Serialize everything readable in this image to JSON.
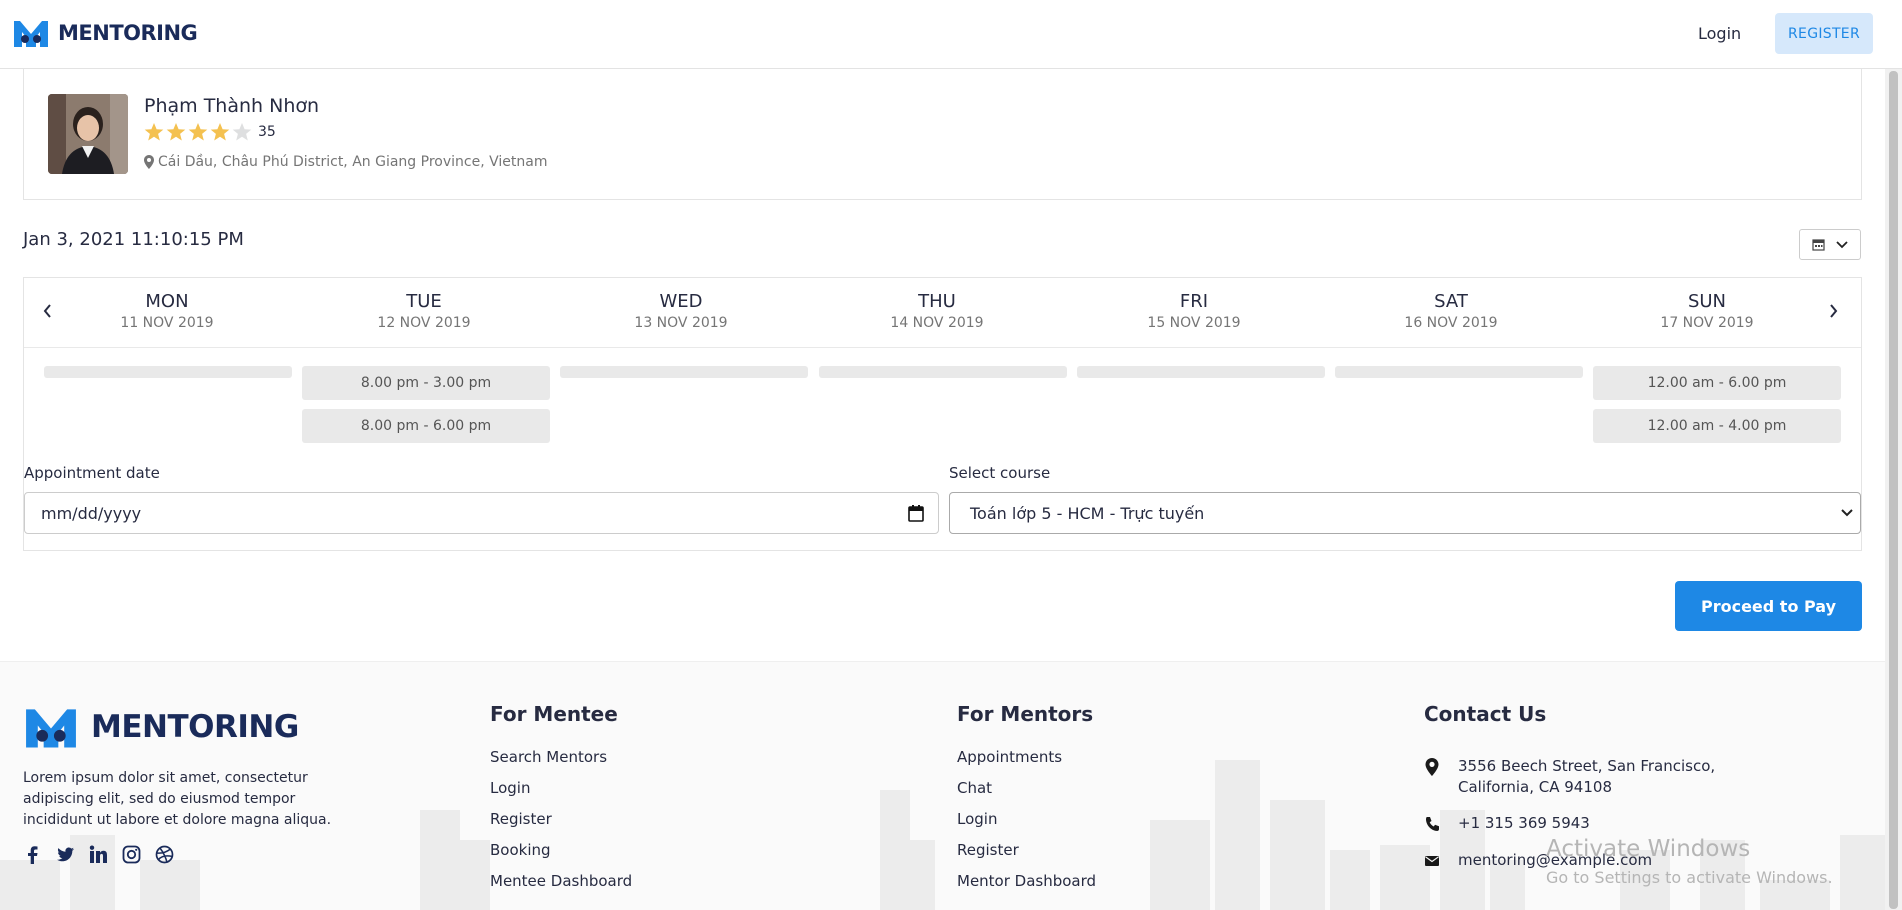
{
  "header": {
    "brand": "MENTORING",
    "login": "Login",
    "register": "REGISTER"
  },
  "mentor": {
    "name": "Phạm Thành Nhơn",
    "rating": 4,
    "rating_max": 5,
    "review_count": "35",
    "location": "Cái Dầu, Châu Phú District, An Giang Province, Vietnam"
  },
  "schedule": {
    "current_datetime": "Jan 3, 2021 11:10:15 PM",
    "days": [
      {
        "name": "MON",
        "date": "11 NOV 2019",
        "slots": []
      },
      {
        "name": "TUE",
        "date": "12 NOV 2019",
        "slots": [
          "8.00 pm - 3.00 pm",
          "8.00 pm - 6.00 pm"
        ]
      },
      {
        "name": "WED",
        "date": "13 NOV 2019",
        "slots": []
      },
      {
        "name": "THU",
        "date": "14 NOV 2019",
        "slots": []
      },
      {
        "name": "FRI",
        "date": "15 NOV 2019",
        "slots": []
      },
      {
        "name": "SAT",
        "date": "16 NOV 2019",
        "slots": []
      },
      {
        "name": "SUN",
        "date": "17 NOV 2019",
        "slots": [
          "12.00 am - 6.00 pm",
          "12.00 am - 4.00 pm"
        ]
      }
    ]
  },
  "form": {
    "date_label": "Appointment date",
    "date_placeholder": "mm/dd/yyyy",
    "course_label": "Select course",
    "course_value": "Toán lớp 5 - HCM - Trực tuyến"
  },
  "pay_button": "Proceed to Pay",
  "footer": {
    "brand": "MENTORING",
    "about": "Lorem ipsum dolor sit amet, consectetur adipiscing elit, sed do eiusmod tempor incididunt ut labore et dolore magna aliqua.",
    "mentee": {
      "title": "For Mentee",
      "links": [
        "Search Mentors",
        "Login",
        "Register",
        "Booking",
        "Mentee Dashboard"
      ]
    },
    "mentors": {
      "title": "For Mentors",
      "links": [
        "Appointments",
        "Chat",
        "Login",
        "Register",
        "Mentor Dashboard"
      ]
    },
    "contact": {
      "title": "Contact Us",
      "address": "3556 Beech Street, San Francisco, California, CA 94108",
      "phone": "+1 315 369 5943",
      "email": "mentoring@example.com"
    }
  },
  "watermark": {
    "line1": "Activate Windows",
    "line2": "Go to Settings to activate Windows."
  },
  "colors": {
    "accent": "#1e88e5",
    "star": "#f4c150",
    "star_empty": "#dedfe0",
    "brand": "#1a2b5a"
  }
}
